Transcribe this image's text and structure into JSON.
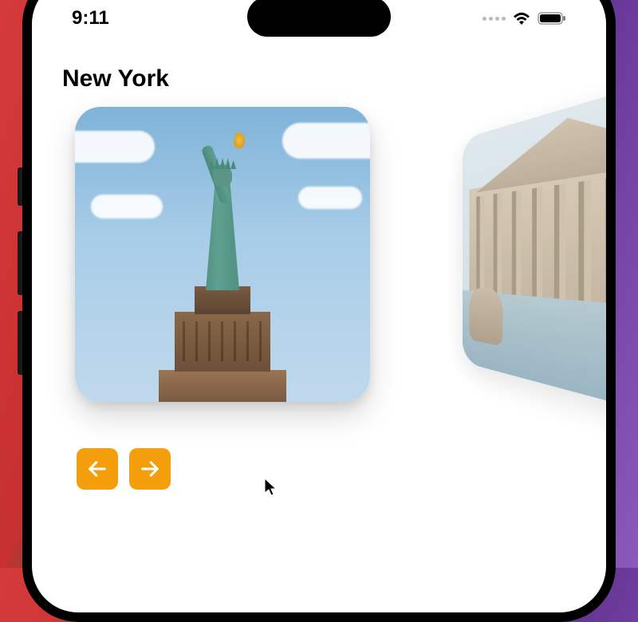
{
  "status": {
    "time": "9:11"
  },
  "page": {
    "title": "New York"
  },
  "carousel": {
    "cards": [
      {
        "name": "new-york",
        "alt": "Statue of Liberty"
      },
      {
        "name": "rome",
        "alt": "Pantheon fountain"
      }
    ]
  },
  "nav": {
    "prev": "Previous",
    "next": "Next"
  },
  "colors": {
    "accent": "#f59e0b"
  }
}
